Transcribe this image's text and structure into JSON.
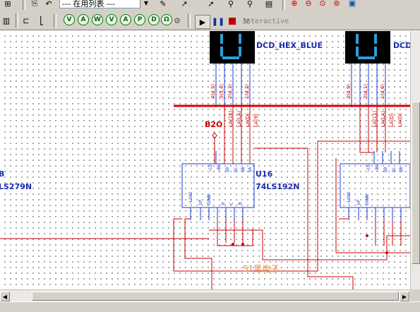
{
  "toolbar": {
    "combo_value": "--- 在用列表 ---",
    "interactive_label": "Interactive",
    "run_icon": "play-icon",
    "pause_icon": "pause-icon",
    "stop_icon": "stop-icon",
    "zoom_icons": [
      "zoom-in-icon",
      "zoom-out-icon",
      "zoom-area-icon",
      "zoom-fit-icon",
      "zoom-full-icon"
    ]
  },
  "schematic": {
    "display1_label": "DCD_HEX_BLUE",
    "display2_label": "DCD_HEX_BLUE",
    "display2_label_visible": "DCD",
    "left_part_ref": "B",
    "left_part_type": "LS279N",
    "counter1_ref": "U16",
    "counter1_type": "74LS192N",
    "net_label": "B2O",
    "watermark": "51黑电子",
    "display1_nets": [
      "4(d,5)",
      "3(d,4)",
      "2(d,3)",
      "1(d,2)"
    ],
    "display2_nets": [
      "3(d,9)",
      "2(d,1)",
      "1(d,6)"
    ],
    "display2_extra_nets": [
      "1(d,0)"
    ],
    "counter1_top_nets": [
      "LA(15)",
      "LA(LA)",
      "LA(D)",
      "LA(9)"
    ],
    "counter2_top_nets": [
      "LA(11)",
      "LA(LA)",
      "LA(D)",
      "LA(D)"
    ],
    "counter1_pins_left": [
      "CLR",
      "UP",
      "DOWN",
      "~LOAD"
    ],
    "counter1_pins_top": [
      "~CO",
      "~BO",
      "QD",
      "QC",
      "QB",
      "QA"
    ],
    "counter1_pins_bottom": [
      "D",
      "C",
      "B",
      "A"
    ],
    "counter2_pins_top": [
      "~CO",
      "~BO",
      "QD",
      "QC",
      "QB",
      "QA"
    ],
    "counter2_pins_left": [
      "CLR",
      "UP",
      "DOWN",
      "~LOAD"
    ],
    "counter2_pins_bottom": [
      "D",
      "C",
      "B",
      "A"
    ]
  },
  "colors": {
    "wire": "#cc0000",
    "bus": "#dd0000",
    "part": "#1a3ad0",
    "display_face": "#000000",
    "segment": "#2a9fd8",
    "label": "#1a2bb0",
    "watermark": "#e0904a"
  }
}
